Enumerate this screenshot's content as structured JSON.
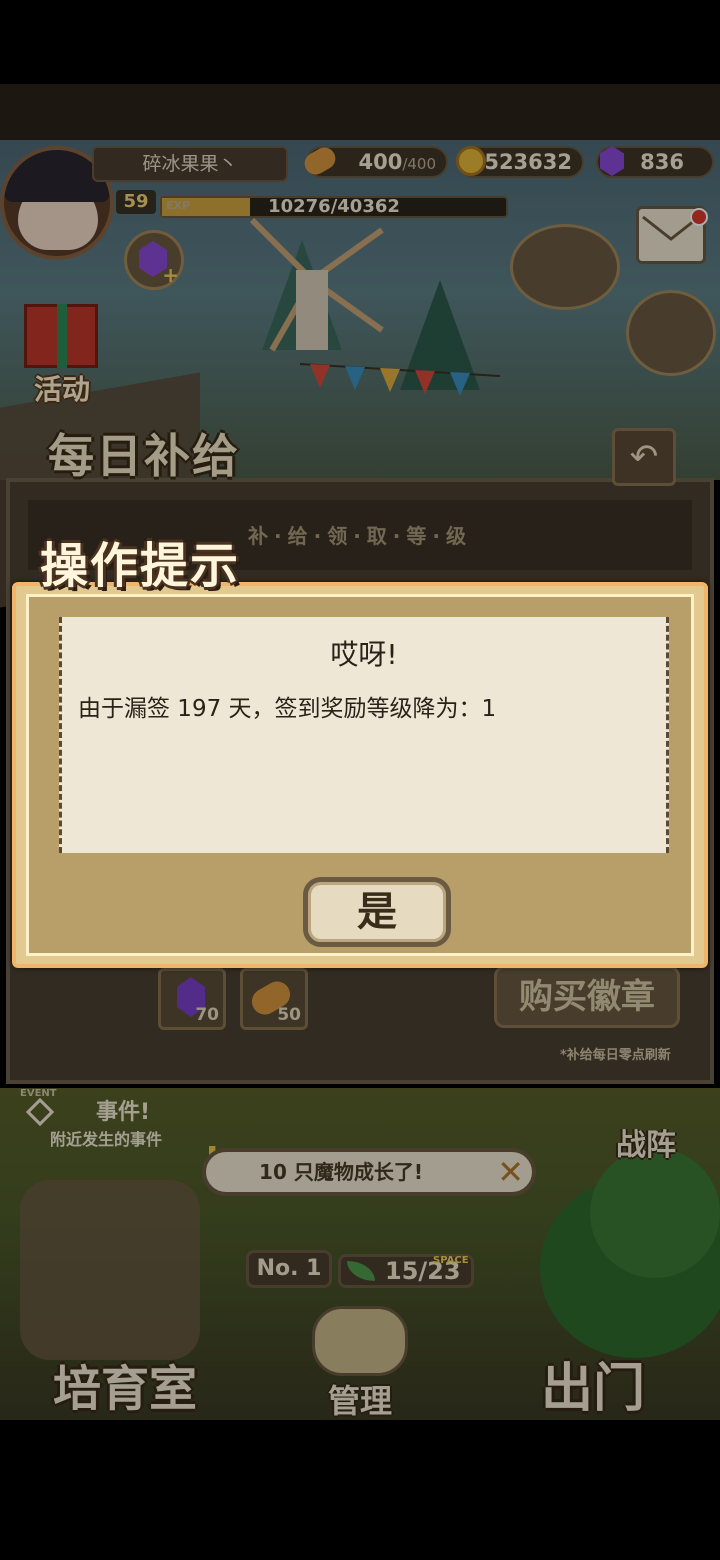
{
  "player": {
    "name": "碎冰果果丶",
    "level": "59",
    "exp_label": "EXP",
    "exp_text": "10276/40362",
    "exp_fraction": 0.2546
  },
  "resources": {
    "bread_current": "400",
    "bread_max": "/400",
    "gold": "523632",
    "gems": "836"
  },
  "left_menu": {
    "activity_label": "活动"
  },
  "supply_panel": {
    "title": "每日补给",
    "subtitle": "补·给·领·取·等·级",
    "gem_reward": "70",
    "bread_reward": "50",
    "buy_badge_label": "购买徽章",
    "refresh_note": "*补给每日零点刷新"
  },
  "dialog": {
    "banner": "操作提示",
    "title": "哎呀!",
    "message": "由于漏签 197 天，签到奖励等级降为：1",
    "confirm_label": "是"
  },
  "bottom": {
    "event_tag": "EVENT",
    "event_title": "事件!",
    "event_subtitle": "附近发生的事件",
    "formation_label": "战阵",
    "notification": "10 只魔物成长了!",
    "rank_label": "No. 1",
    "space_tag": "SPACE",
    "space_value": "15/23",
    "nav_nursery": "培育室",
    "nav_manage": "管理",
    "nav_exit": "出门"
  },
  "colors": {
    "accent_gold": "#d0a640",
    "gem_purple": "#8a4bd8",
    "notification_red": "#d93a2a",
    "dialog_border": "#f0b46a"
  }
}
